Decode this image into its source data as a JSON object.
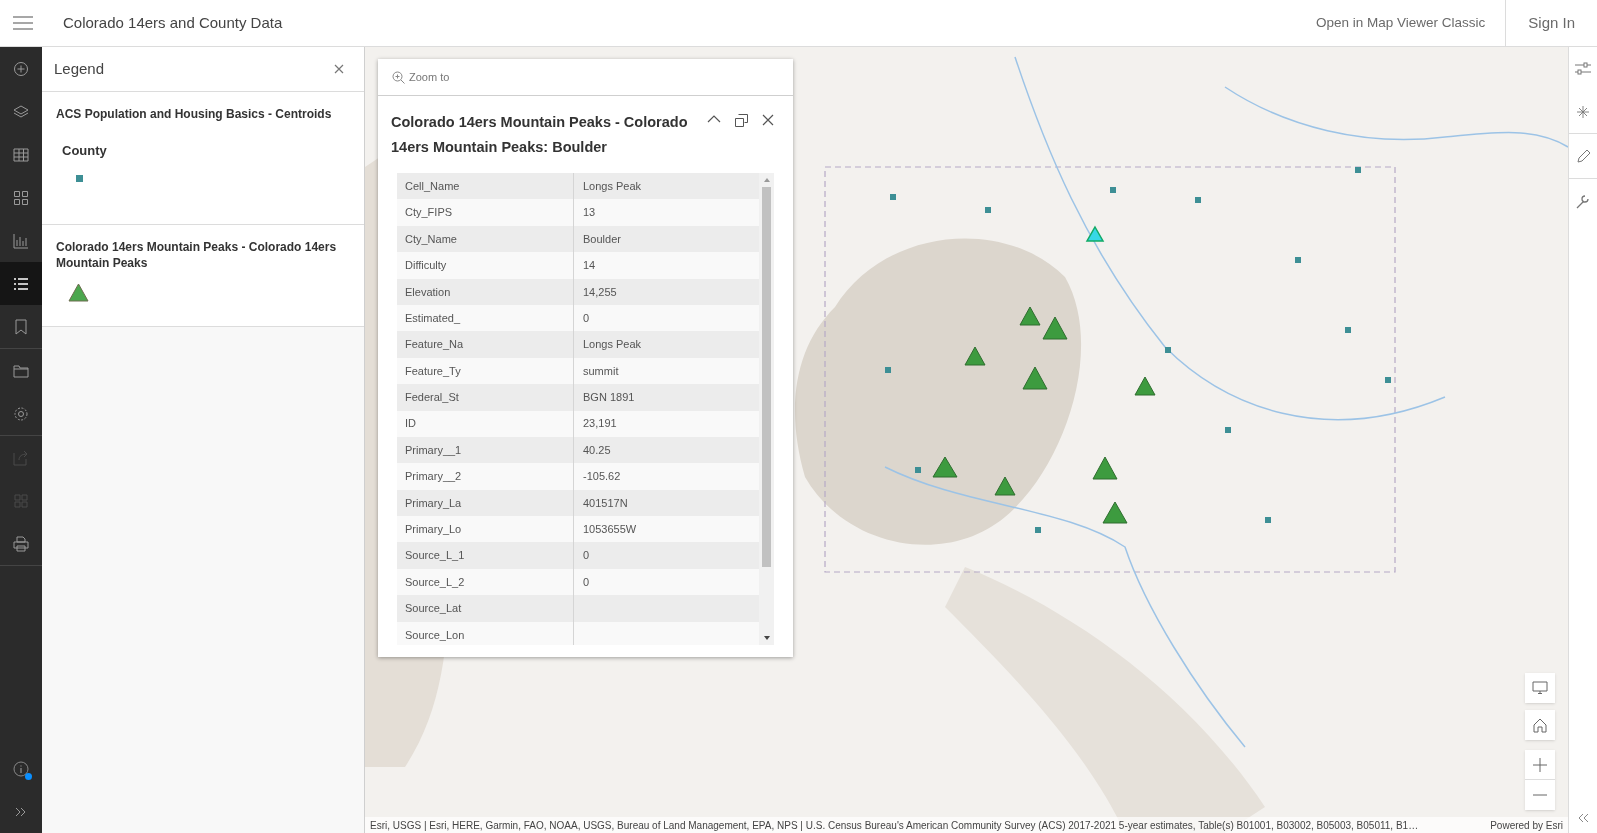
{
  "header": {
    "title": "Colorado 14ers and County Data",
    "links": [
      "Open in Map Viewer Classic",
      "Sign In"
    ]
  },
  "toolbar": {
    "groups": [
      [
        {
          "selected": false,
          "disabled": false
        },
        {
          "selected": false,
          "disabled": false
        },
        {
          "selected": false,
          "disabled": false
        },
        {
          "selected": false,
          "disabled": false
        },
        {
          "selected": false,
          "disabled": false
        },
        {
          "selected": true,
          "disabled": false
        },
        {
          "selected": false,
          "disabled": false
        }
      ],
      [
        {
          "selected": false,
          "disabled": false
        },
        {
          "selected": false,
          "disabled": false
        }
      ],
      [
        {
          "selected": false,
          "disabled": true
        },
        {
          "selected": false,
          "disabled": true
        },
        {
          "selected": false,
          "disabled": false
        }
      ]
    ],
    "info_badge": true
  },
  "legend": {
    "title": "Legend",
    "layers": [
      {
        "title": "ACS Population and Housing Basics - Centroids",
        "subtitle": "County",
        "kind": "square"
      },
      {
        "title": "Colorado 14ers Mountain Peaks - Colorado 14ers Mountain Peaks",
        "kind": "triangle"
      }
    ]
  },
  "popup": {
    "zoom_to": "Zoom to",
    "title": "Colorado 14ers Mountain Peaks - Colorado 14ers Mountain Peaks: Boulder",
    "fields": [
      {
        "name": "Cell_Name",
        "value": "Longs Peak"
      },
      {
        "name": "Cty_FIPS",
        "value": "13"
      },
      {
        "name": "Cty_Name",
        "value": "Boulder"
      },
      {
        "name": "Difficulty",
        "value": "14"
      },
      {
        "name": "Elevation",
        "value": "14,255"
      },
      {
        "name": "Estimated_",
        "value": "0"
      },
      {
        "name": "Feature_Na",
        "value": "Longs Peak"
      },
      {
        "name": "Feature_Ty",
        "value": "summit"
      },
      {
        "name": "Federal_St",
        "value": "BGN 1891"
      },
      {
        "name": "ID",
        "value": "23,191"
      },
      {
        "name": "Primary__1",
        "value": "40.25"
      },
      {
        "name": "Primary__2",
        "value": "-105.62"
      },
      {
        "name": "Primary_La",
        "value": "401517N"
      },
      {
        "name": "Primary_Lo",
        "value": "1053655W"
      },
      {
        "name": "Source_L_1",
        "value": "0"
      },
      {
        "name": "Source_L_2",
        "value": "0"
      },
      {
        "name": "Source_Lat"
      },
      {
        "name": "Source_Lon"
      }
    ]
  },
  "map": {
    "attribution": "Esri, USGS | Esri, HERE, Garmin, FAO, NOAA, USGS, Bureau of Land Management, EPA, NPS | U.S. Census Bureau's American Community Survey (ACS) 2017-2021 5-year estimates, Table(s) B01001, B03002, B05003, B05011, B1…",
    "powered_by": "Powered by Esri"
  }
}
